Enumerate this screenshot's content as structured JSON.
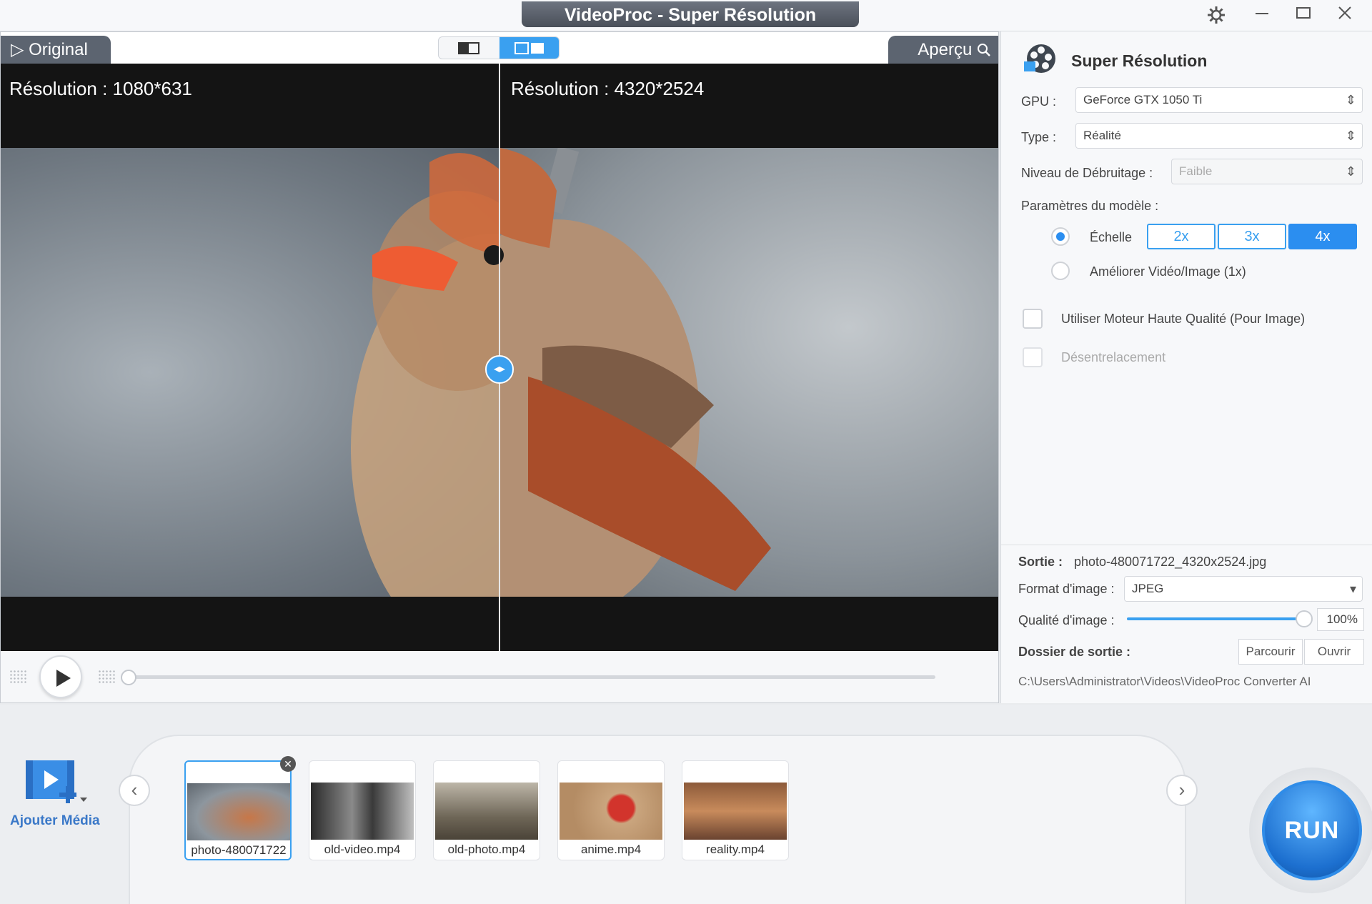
{
  "window": {
    "title": "VideoProc - Super Résolution",
    "controls": [
      "settings",
      "minimize",
      "maximize",
      "close"
    ]
  },
  "preview": {
    "tab_original": "Original",
    "tab_apercu": "Aperçu",
    "left_resolution": "Résolution : 1080*631",
    "right_resolution": "Résolution : 4320*2524",
    "accent_color": "#3aa0f0"
  },
  "panel": {
    "title": "Super Résolution",
    "gpu_label": "GPU :",
    "gpu_value": "GeForce GTX 1050 Ti",
    "type_label": "Type :",
    "type_value": "Réalité",
    "denoise_label": "Niveau de Débruitage :",
    "denoise_value": "Faible",
    "model_params_label": "Paramètres du modèle :",
    "scale_label": "Échelle",
    "scale_options": [
      "2x",
      "3x",
      "4x"
    ],
    "scale_selected": "4x",
    "enhance_label": "Améliorer Vidéo/Image (1x)",
    "hq_engine_label": "Utiliser Moteur Haute Qualité (Pour Image)",
    "deinterlace_label": "Désentrelacement",
    "output_label": "Sortie :",
    "output_file": "photo-480071722_4320x2524.jpg",
    "format_label": "Format d'image :",
    "format_value": "JPEG",
    "quality_label": "Qualité d'image :",
    "quality_value": "100%",
    "quality_fraction": 1.0,
    "output_folder_label": "Dossier de sortie :",
    "browse_label": "Parcourir",
    "open_label": "Ouvrir",
    "output_path": "C:\\Users\\Administrator\\Videos\\VideoProc Converter AI"
  },
  "media": {
    "add_label": "Ajouter Média",
    "items": [
      {
        "name": "photo-480071722",
        "selected": true
      },
      {
        "name": "old-video.mp4",
        "selected": false
      },
      {
        "name": "old-photo.mp4",
        "selected": false
      },
      {
        "name": "anime.mp4",
        "selected": false
      },
      {
        "name": "reality.mp4",
        "selected": false
      }
    ],
    "run_label": "RUN"
  }
}
